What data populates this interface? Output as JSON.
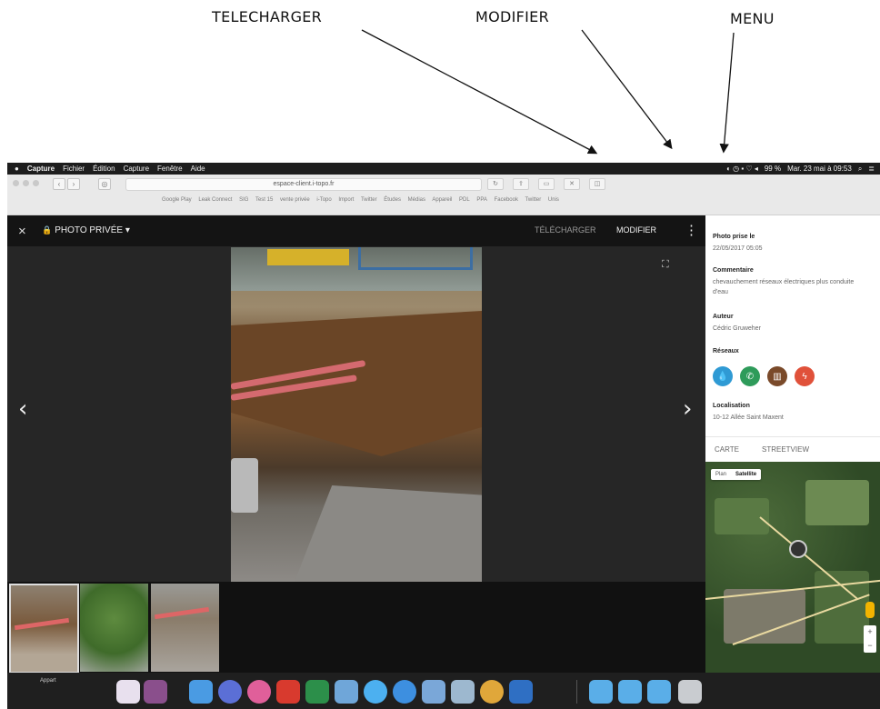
{
  "annotations": {
    "telecharger": "TELECHARGER",
    "modifier": "MODIFIER",
    "menu": "MENU"
  },
  "menubar": {
    "apple": "",
    "app_name": "Capture",
    "items": [
      "Fichier",
      "Édition",
      "Capture",
      "Fenêtre",
      "Aide"
    ],
    "battery": "99 %",
    "datetime": "Mar. 23 mai à 09:53"
  },
  "browser": {
    "url": "espace-client.i-topo.fr",
    "bookmarks": [
      "Google Play",
      "Leak Connect",
      "SIG",
      "Test 15",
      "vente privée",
      "i-Topo",
      "Import",
      "Twitter",
      "Études",
      "Médias",
      "Appareil",
      "PDL",
      "PPA",
      "Facebook",
      "Twitter",
      "Unis"
    ]
  },
  "viewer": {
    "close_icon": "×",
    "privacy_label": "PHOTO PRIVÉE",
    "privacy_caret": "▾",
    "telecharger_label": "TÉLÉCHARGER",
    "modifier_label": "MODIFIER",
    "menu_icon": "⋮",
    "fullscreen_icon": "⛶",
    "prev_icon": "‹",
    "next_icon": "›"
  },
  "info": {
    "taken_label": "Photo prise le",
    "taken_value": "22/05/2017 05:05",
    "comment_label": "Commentaire",
    "comment_value": "chevauchement réseaux électriques plus conduite d'eau",
    "author_label": "Auteur",
    "author_value": "Cédric Gruweher",
    "networks_label": "Réseaux",
    "network_icons": [
      {
        "name": "water-icon",
        "glyph": "💧",
        "color": "#2f9ad4"
      },
      {
        "name": "phone-icon",
        "glyph": "✆",
        "color": "#2e9b5a"
      },
      {
        "name": "sewer-icon",
        "glyph": "▥",
        "color": "#7a4a2a"
      },
      {
        "name": "electric-icon",
        "glyph": "ϟ",
        "color": "#e0513a"
      }
    ],
    "location_label": "Localisation",
    "location_value": "10-12 Allée Saint Maxent",
    "tab_carte": "CARTE",
    "tab_streetview": "STREETVIEW"
  },
  "map": {
    "plan": "Plan",
    "satellite": "Satellite",
    "zoom_in": "+",
    "zoom_out": "−"
  },
  "dock": {
    "appart": "Appart"
  }
}
